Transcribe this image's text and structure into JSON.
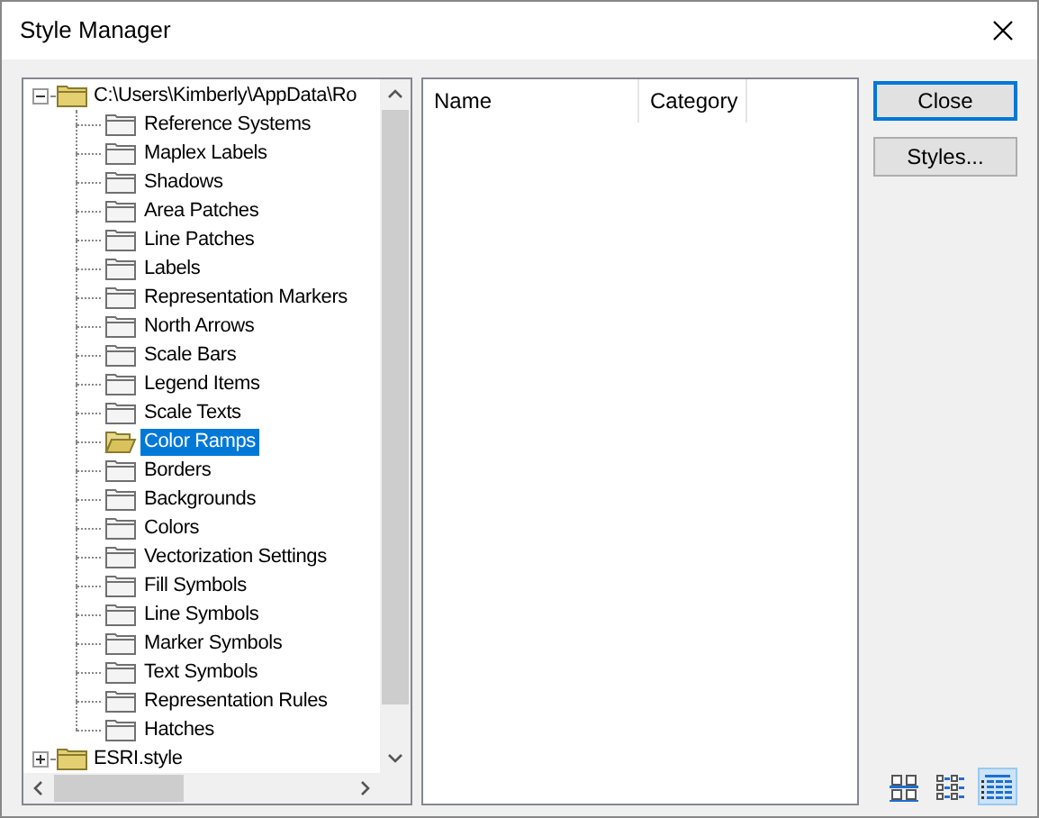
{
  "window": {
    "title": "Style Manager"
  },
  "tree": [
    {
      "label": "C:\\Users\\Kimberly\\AppData\\Ro",
      "expanded": true,
      "selected": false,
      "children": [
        {
          "label": "Reference Systems",
          "selected": false
        },
        {
          "label": "Maplex Labels",
          "selected": false
        },
        {
          "label": "Shadows",
          "selected": false
        },
        {
          "label": "Area Patches",
          "selected": false
        },
        {
          "label": "Line Patches",
          "selected": false
        },
        {
          "label": "Labels",
          "selected": false
        },
        {
          "label": "Representation Markers",
          "selected": false
        },
        {
          "label": "North Arrows",
          "selected": false
        },
        {
          "label": "Scale Bars",
          "selected": false
        },
        {
          "label": "Legend Items",
          "selected": false
        },
        {
          "label": "Scale Texts",
          "selected": false
        },
        {
          "label": "Color Ramps",
          "selected": true
        },
        {
          "label": "Borders",
          "selected": false
        },
        {
          "label": "Backgrounds",
          "selected": false
        },
        {
          "label": "Colors",
          "selected": false
        },
        {
          "label": "Vectorization Settings",
          "selected": false
        },
        {
          "label": "Fill Symbols",
          "selected": false
        },
        {
          "label": "Line Symbols",
          "selected": false
        },
        {
          "label": "Marker Symbols",
          "selected": false
        },
        {
          "label": "Text Symbols",
          "selected": false
        },
        {
          "label": "Representation Rules",
          "selected": false
        },
        {
          "label": "Hatches",
          "selected": false
        }
      ]
    },
    {
      "label": "ESRI.style",
      "expanded": false,
      "selected": false
    }
  ],
  "list": {
    "columns": [
      "Name",
      "Category"
    ]
  },
  "buttons": [
    {
      "label": "Close",
      "default": true
    },
    {
      "label": "Styles...",
      "default": false
    }
  ],
  "view_modes": [
    {
      "kind": "large-icons",
      "selected": false
    },
    {
      "kind": "small-icons",
      "selected": false
    },
    {
      "kind": "details",
      "selected": true
    }
  ]
}
